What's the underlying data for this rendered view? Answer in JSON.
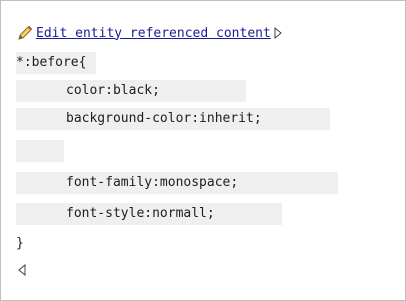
{
  "link": {
    "label": "Edit entity referenced content"
  },
  "code": {
    "selector": "*:before{",
    "lines": [
      "color:black;",
      "background-color:inherit;",
      "",
      "font-family:monospace;",
      "font-style:normall;"
    ],
    "closing": "}"
  },
  "icons": {
    "edit": "pencil-icon",
    "end_marker": "end-tag-marker-icon",
    "begin_marker": "start-tag-marker-icon"
  },
  "colors": {
    "link": "#1c1c9a",
    "line_background": "#efefef",
    "border": "#bfbfbf"
  }
}
